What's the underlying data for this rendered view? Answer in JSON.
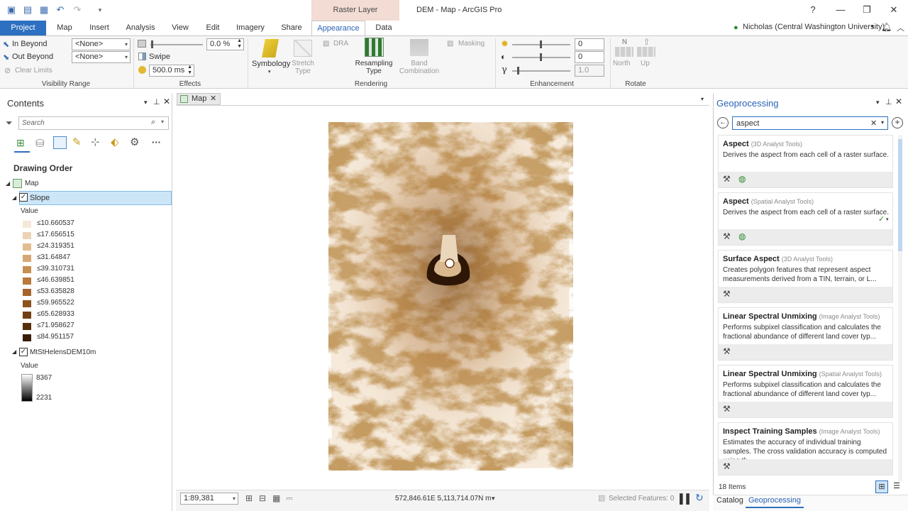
{
  "app": {
    "window_title": "DEM - Map - ArcGIS Pro",
    "context_tab": "Raster Layer",
    "user": "Nicholas (Central Washington University)"
  },
  "tabs": [
    "Project",
    "Map",
    "Insert",
    "Analysis",
    "View",
    "Edit",
    "Imagery",
    "Share",
    "Appearance",
    "Data"
  ],
  "ribbon": {
    "in_beyond": "In Beyond",
    "out_beyond": "Out Beyond",
    "clear_limits": "Clear Limits",
    "in_beyond_value": "<None>",
    "out_beyond_value": "<None>",
    "visibility_range": "Visibility Range",
    "transparency": "0.0 %",
    "swipe": "Swipe",
    "flicker": "500.0  ms",
    "effects": "Effects",
    "symbology": "Symbology",
    "stretch_type": "Stretch Type",
    "dra": "DRA",
    "resampling_type": "Resampling Type",
    "band_combination": "Band Combination",
    "masking": "Masking",
    "rendering": "Rendering",
    "brightness": "0",
    "contrast": "0",
    "gamma": "1.0",
    "enhancement": "Enhancement",
    "north": "North",
    "up": "Up",
    "rotate": "Rotate"
  },
  "contents": {
    "title": "Contents",
    "search_placeholder": "Search",
    "drawing_order": "Drawing Order",
    "map": "Map",
    "slope_layer": "Slope",
    "value_label": "Value",
    "slope_classes": [
      {
        "label": "≤10.660537",
        "color": "#f5e8d8"
      },
      {
        "label": "≤17.656515",
        "color": "#ecd3b6"
      },
      {
        "label": "≤24.319351",
        "color": "#e2bd92"
      },
      {
        "label": "≤31.64847",
        "color": "#d8a874"
      },
      {
        "label": "≤39.310731",
        "color": "#c98f52"
      },
      {
        "label": "≤46.639851",
        "color": "#b97a3c"
      },
      {
        "label": "≤53.635828",
        "color": "#a5652a"
      },
      {
        "label": "≤59.965522",
        "color": "#8d511c"
      },
      {
        "label": "≤65.628933",
        "color": "#723f13"
      },
      {
        "label": "≤71.958627",
        "color": "#562e0c"
      },
      {
        "label": "≤84.951157",
        "color": "#3a1d06"
      }
    ],
    "dem_layer": "MtStHelensDEM10m",
    "dem_value_label": "Value",
    "dem_high": "8367",
    "dem_low": "2231"
  },
  "map": {
    "tab": "Map",
    "scale": "1:89,381",
    "coords": "572,846.61E 5,113,714.07N m",
    "selected": "Selected Features: 0"
  },
  "geoprocessing": {
    "title": "Geoprocessing",
    "search_value": "aspect",
    "items_count": "18 Items",
    "tools": [
      {
        "name": "Aspect",
        "toolbox": "(3D Analyst Tools)",
        "desc": "Derives the aspect from each cell of a raster surface.",
        "licensed": true
      },
      {
        "name": "Aspect",
        "toolbox": "(Spatial Analyst Tools)",
        "desc": "Derives the aspect from each cell of a raster surface.",
        "licensed": true
      },
      {
        "name": "Surface Aspect",
        "toolbox": "(3D Analyst Tools)",
        "desc": "Creates polygon features that represent aspect measurements derived  from a TIN, terrain, or L...",
        "licensed": false
      },
      {
        "name": "Linear Spectral Unmixing",
        "toolbox": "(Image Analyst Tools)",
        "desc": "Performs subpixel classification and calculates the fractional abundance  of  different land cover typ...",
        "licensed": false
      },
      {
        "name": "Linear Spectral Unmixing",
        "toolbox": "(Spatial Analyst Tools)",
        "desc": "Performs subpixel classification and calculates the fractional abundance  of  different land cover typ...",
        "licensed": false
      },
      {
        "name": "Inspect Training Samples",
        "toolbox": "(Image Analyst Tools)",
        "desc": "Estimates the accuracy of individual training samples. The cross validation accuracy is computed using th...",
        "licensed": false
      }
    ],
    "bottom_tabs": [
      "Catalog",
      "Geoprocessing"
    ]
  }
}
